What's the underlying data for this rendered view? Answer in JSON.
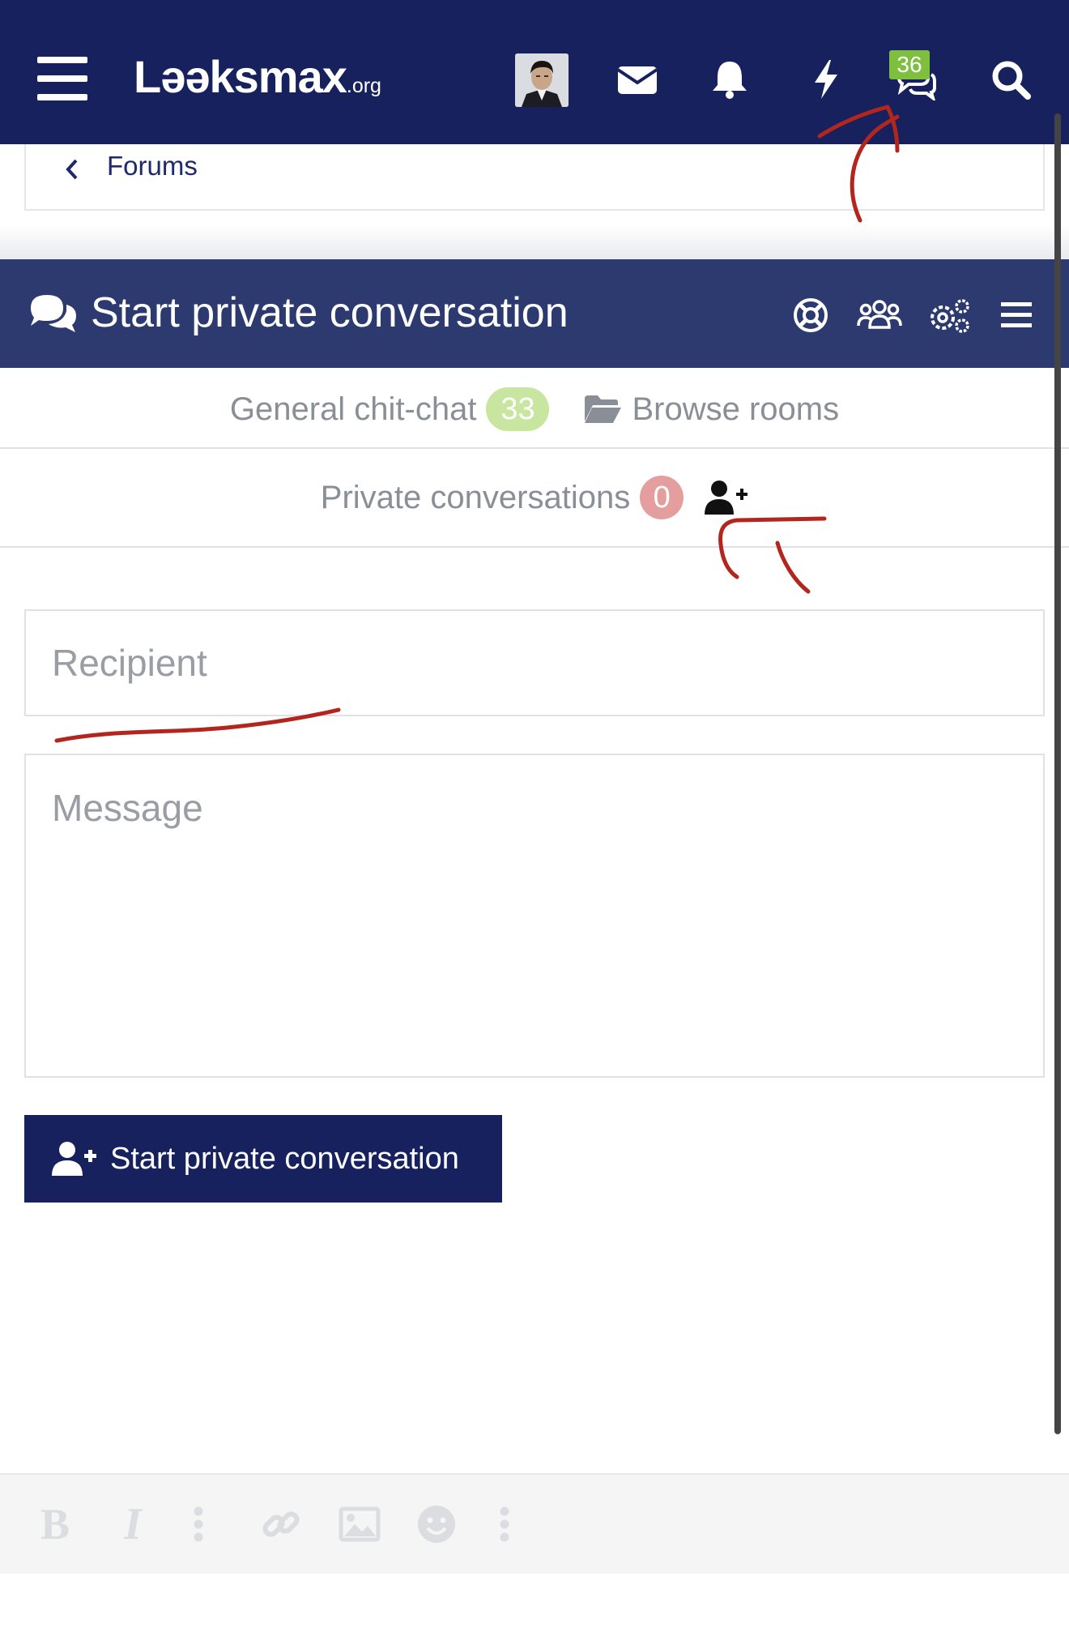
{
  "header": {
    "logo_main": "Lǝǝksmax",
    "logo_suffix": ".org",
    "icons": [
      "hamburger-icon",
      "avatar",
      "envelope-icon",
      "bell-icon",
      "bolt-icon",
      "chat-icon",
      "search-icon"
    ],
    "chat_badge": "36",
    "colors": {
      "header_bg": "#17215e",
      "badge": "#7fbf3f"
    }
  },
  "breadcrumb": {
    "label": "Forums"
  },
  "chat": {
    "title": "Start private conversation",
    "tools": [
      "lifebuoy-icon",
      "users-icon",
      "settings-icon",
      "menu-icon"
    ],
    "colors": {
      "header_bg": "#2c3a70"
    }
  },
  "rooms": {
    "general_label": "General chit-chat",
    "general_count": "33",
    "browse_label": "Browse rooms",
    "private_label": "Private conversations",
    "private_count": "0"
  },
  "form": {
    "recipient_placeholder": "Recipient",
    "message_placeholder": "Message",
    "submit_label": "Start private conversation"
  },
  "editor": {
    "bold_label": "B",
    "italic_label": "I",
    "icons": [
      "bold-icon",
      "italic-icon",
      "more-options-icon",
      "link-icon",
      "image-icon",
      "smiley-icon",
      "more-options-icon"
    ]
  },
  "annotation_color": "#b3261e"
}
